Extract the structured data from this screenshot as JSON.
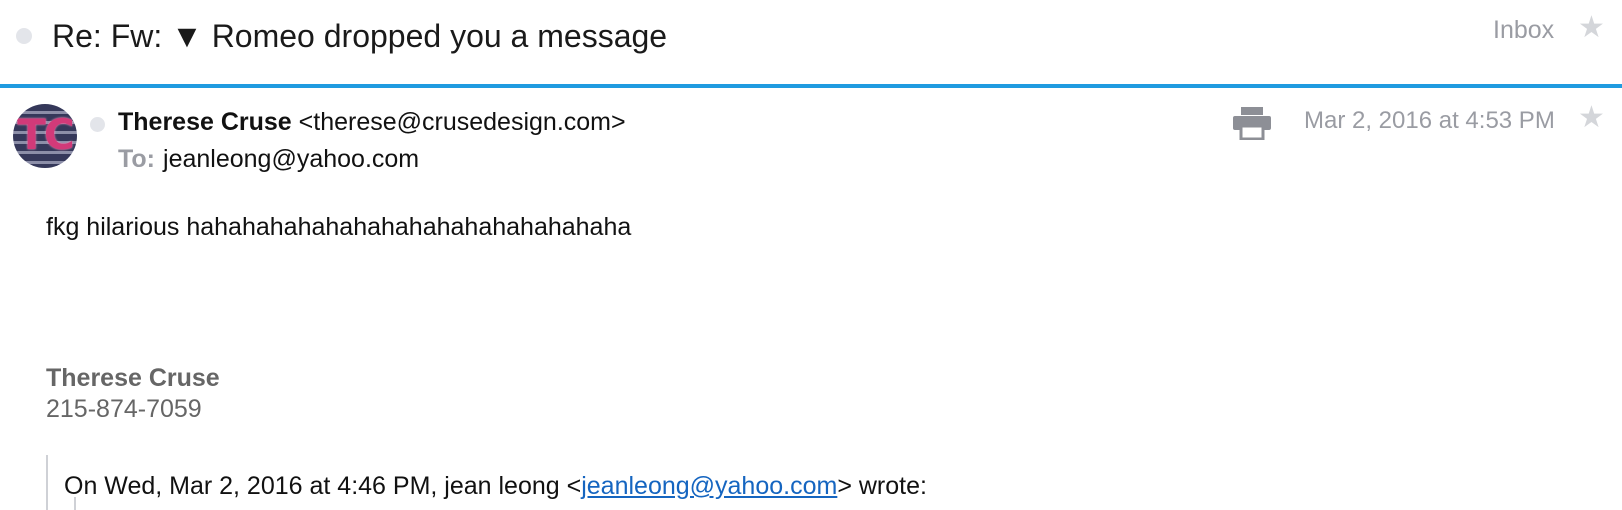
{
  "subject_bar": {
    "subject": "Re: Fw: ▼ Romeo dropped you a message",
    "folder": "Inbox",
    "star_icon": "star-icon"
  },
  "message": {
    "avatar_initials": "TC",
    "from_name": "Therese Cruse",
    "from_email": "<therese@crusedesign.com>",
    "to_label": "To:",
    "to_value": "jeanleong@yahoo.com",
    "date": "Mar 2, 2016 at 4:53 PM",
    "print_icon": "print-icon",
    "body": "fkg hilarious hahahahahahahahahahahahahahahaha",
    "signature": {
      "name": "Therese Cruse",
      "phone": "215-874-7059"
    },
    "quote": {
      "prefix": "On Wed, Mar 2, 2016 at 4:46 PM, jean leong <",
      "link": "jeanleong@yahoo.com",
      "suffix": "> wrote:"
    }
  },
  "colors": {
    "accent": "#1f9be0",
    "muted": "#9a9ca3",
    "link": "#1565c0"
  }
}
